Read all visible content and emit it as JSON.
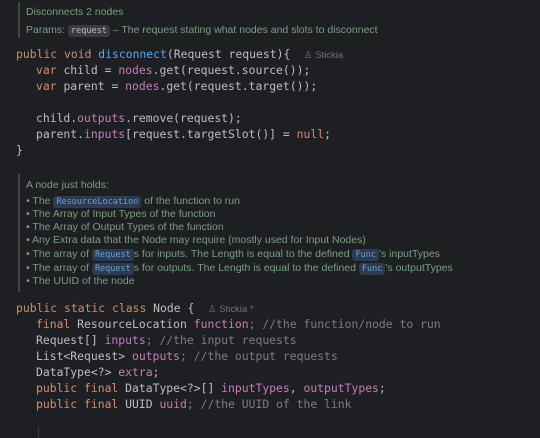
{
  "doc1": {
    "title": "Disconnects 2 nodes",
    "params_label": "Params:",
    "params_chip": "request",
    "params_desc": "– The request stating what nodes and slots to disconnect"
  },
  "code1": {
    "l1_kw": "public void ",
    "l1_fn": "disconnect",
    "l1_rest": "(Request request){",
    "l1_author": "Stickia",
    "l2_kw": "var ",
    "l2_a": "child = ",
    "l2_fld": "nodes",
    "l2_b": ".get(request.source());",
    "l3_kw": "var ",
    "l3_a": "parent = ",
    "l3_fld": "nodes",
    "l3_b": ".get(request.target());",
    "l4_a": "child.",
    "l4_fld": "outputs",
    "l4_b": ".remove(request);",
    "l5_a": "parent.",
    "l5_fld": "inputs",
    "l5_b": "[request.targetSlot()] = ",
    "l5_kw": "null",
    "l5_c": ";",
    "l6": "}"
  },
  "doc2": {
    "title": "A node just holds:",
    "b1_a": "The ",
    "b1_chip": "ResourceLocation",
    "b1_b": " of the function to run",
    "b2": "The Array of Input Types of the function",
    "b3": "The Array of Output Types of the function",
    "b4": "Any Extra data that the Node may require (mostly used for Input Nodes)",
    "b5_a": "The array of ",
    "b5_chip": "Request",
    "b5_b": "s for inputs. The Length is equal to the defined ",
    "b5_chip2": "Func",
    "b5_c": "'s inputTypes",
    "b6_a": "The array of ",
    "b6_chip": "Request",
    "b6_b": "s for outputs. The Length is equal to the defined ",
    "b6_chip2": "Func",
    "b6_c": "'s outputTypes",
    "b7": "The UUID of the node"
  },
  "code2": {
    "l1_kw": "public static class ",
    "l1_a": "Node {",
    "l1_author": "Stickia *",
    "l2_kw": "final ",
    "l2_a": "ResourceLocation ",
    "l2_fld": "function",
    "l2_cm": "; //the function/node to run",
    "l3_a": "Request[] ",
    "l3_fld": "inputs",
    "l3_cm": "; //the input requests",
    "l4_a": "List<Request> ",
    "l4_fld": "outputs",
    "l4_cm": "; //the output requests",
    "l5_a": "DataType<?> ",
    "l5_fld": "extra",
    "l5_b": ";",
    "l6_kw": "public final ",
    "l6_a": "DataType<?>[] ",
    "l6_fld": "inputTypes",
    "l6_b": ", ",
    "l6_fld2": "outputTypes",
    "l6_c": ";",
    "l7_kw": "public final ",
    "l7_a": "UUID ",
    "l7_fld": "uuid",
    "l7_cm": "; //the UUID of the link"
  },
  "colors": {
    "background": "#1e1f22",
    "keyword": "#cf8e6d",
    "field": "#c77dbb",
    "method": "#56a8f5",
    "comment": "#7a7e85",
    "doc_text": "#7a9f7f"
  }
}
